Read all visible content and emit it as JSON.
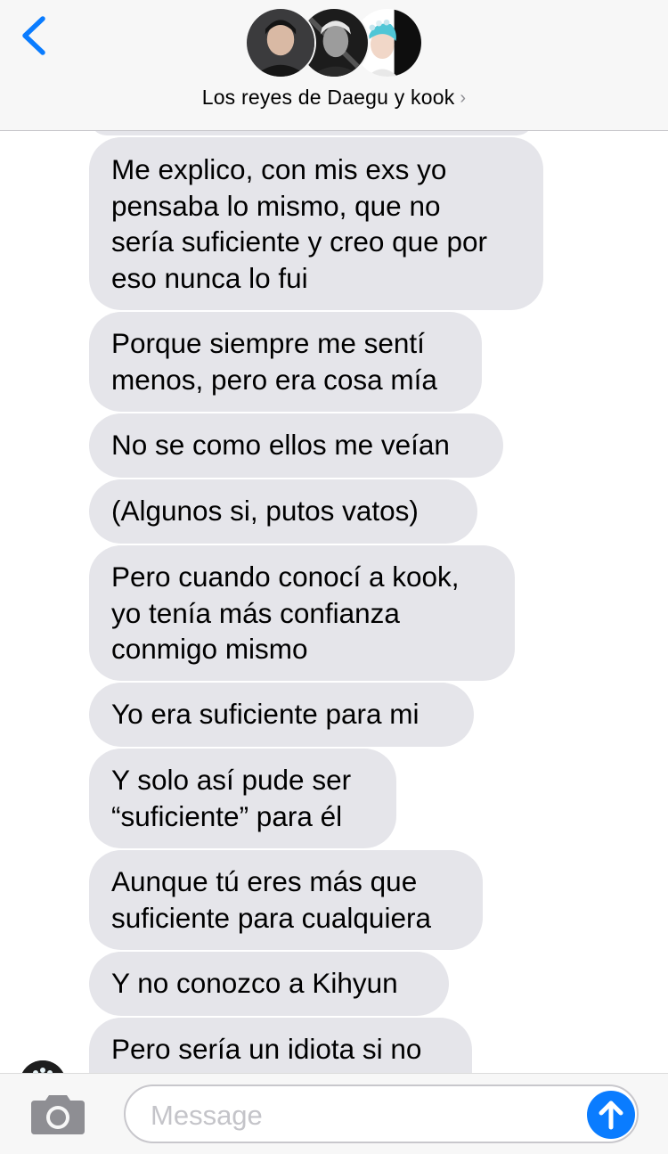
{
  "header": {
    "title": "Los reyes de Daegu y kook",
    "chevron": "›",
    "back_icon": "chevron-left-icon",
    "accent_color": "#0a7cff"
  },
  "messages": [
    {
      "lines": [
        "Me explico, con mis exs yo",
        "pensaba lo mismo, que no",
        "sería suficiente y creo que por",
        "eso nunca lo fui"
      ]
    },
    {
      "lines": [
        "Porque siempre me sentí",
        "menos, pero era cosa mía"
      ]
    },
    {
      "lines": [
        "No se como ellos me veían"
      ]
    },
    {
      "lines": [
        "(Algunos si, putos vatos)"
      ]
    },
    {
      "lines": [
        "Pero cuando conocí a kook,",
        "yo tenía más confianza",
        "conmigo mismo"
      ]
    },
    {
      "lines": [
        "Yo era suficiente para mi"
      ]
    },
    {
      "lines": [
        "Y solo así pude ser",
        "“suficiente” para él"
      ]
    },
    {
      "lines": [
        "Aunque tú eres más que",
        "suficiente para cualquiera"
      ]
    },
    {
      "lines": [
        "Y no conozco a Kihyun"
      ]
    },
    {
      "lines": [
        "Pero sería un idiota si no"
      ]
    }
  ],
  "input": {
    "placeholder": "Message",
    "camera_icon": "camera-icon",
    "send_icon": "arrow-up-icon"
  },
  "colors": {
    "received_bubble": "#e5e5ea",
    "send_button": "#0a7cff"
  }
}
